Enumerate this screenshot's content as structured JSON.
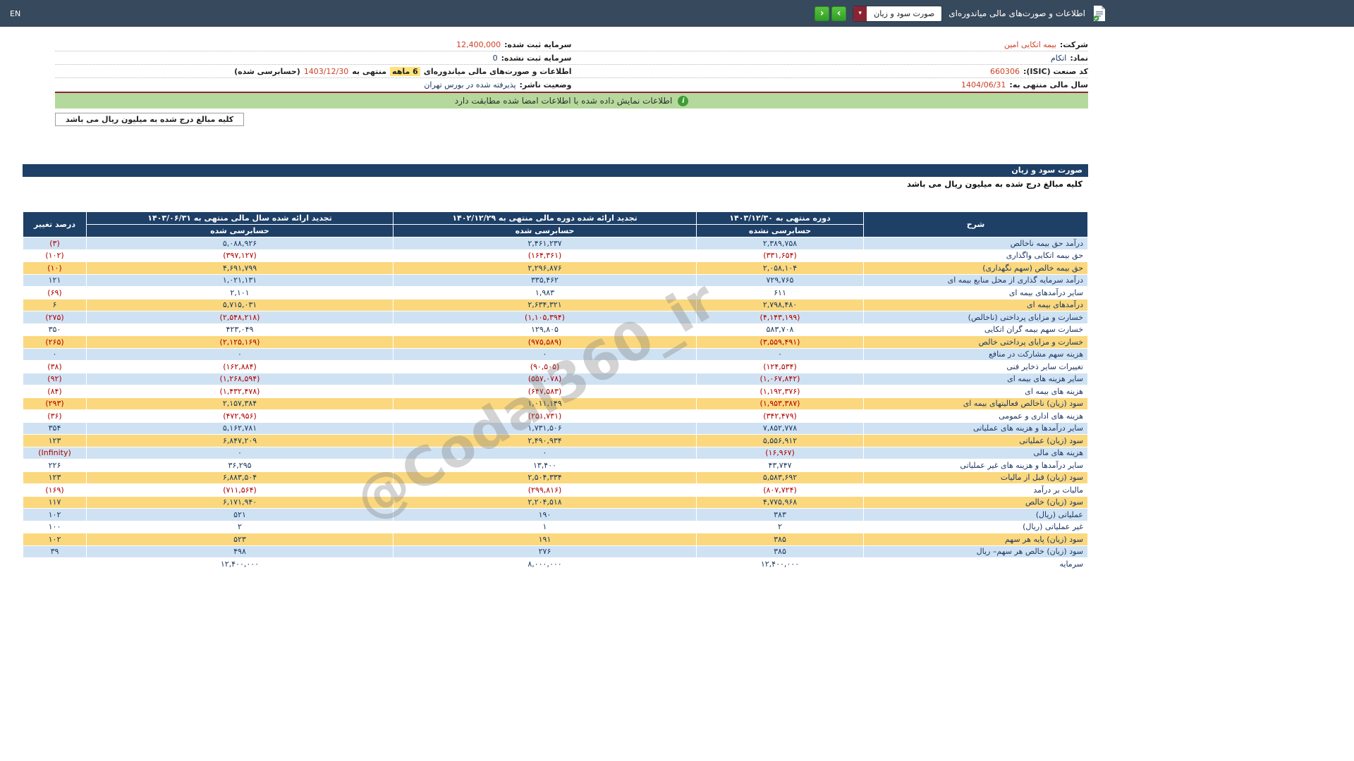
{
  "topbar": {
    "title": "اطلاعات و صورت‌های مالی میاندوره‌ای",
    "select_value": "صورت سود و زیان",
    "en_label": "EN"
  },
  "icons": {
    "dropdown_arrow": "▾",
    "nav_left": "‹",
    "nav_right": "›",
    "info_mark": "i"
  },
  "info": {
    "company_label": "شرکت:",
    "company_value": "بیمه اتکایی امین",
    "symbol_label": "نماد:",
    "symbol_value": "اتکام",
    "isic_label": "کد صنعت (ISIC):",
    "isic_value": "660306",
    "fiscal_year_label": "سال مالی منتهی به:",
    "fiscal_year_value": "1404/06/31",
    "registered_capital_label": "سرمایه ثبت شده:",
    "registered_capital_value": "12,400,000",
    "unregistered_capital_label": "سرمایه ثبت نشده:",
    "unregistered_capital_value": "0",
    "interim": {
      "prefix": "اطلاعات و صورت‌های مالی میاندوره‌ای",
      "highlight": "6 ماهه",
      "mid": "منتهی به",
      "date": "1403/12/30",
      "suffix": "(حسابرسی شده)"
    },
    "status_label": "وضعیت ناشر:",
    "status_value": "پذیرفته شده در بورس تهران",
    "signed_notice": "اطلاعات نمایش داده شده با اطلاعات امضا شده مطابقت دارد",
    "unit_note": "کلیه مبالغ درج شده به میلیون ریال می باشد"
  },
  "section": {
    "title": "صورت سود و زیان",
    "unit_note": "کلیه مبالغ درج شده به میلیون ریال می باشد"
  },
  "watermark": "@Codal360_ir",
  "table": {
    "headers": {
      "desc": "شرح",
      "col1": "دوره منتهی به ۱۴۰۳/۱۲/۳۰",
      "col1_sub": "حسابرسی نشده",
      "col2": "تجدید ارائه شده دوره مالی منتهی به ۱۴۰۲/۱۲/۲۹",
      "col2_sub": "حسابرسی شده",
      "col3": "تجدید ارائه شده سال مالی منتهی به ۱۴۰۳/۰۶/۳۱",
      "col3_sub": "حسابرسی شده",
      "change": "درصد تغییر"
    },
    "rows": [
      {
        "label": "درآمد حق بیمه ناخالص",
        "values": [
          "۲,۳۸۹,۷۵۸",
          "۲,۴۶۱,۲۳۷",
          "۵,۰۸۸,۹۲۶"
        ],
        "change": "(۳)",
        "bg": "blue"
      },
      {
        "label": "حق بیمه اتکایی واگذاری",
        "values": [
          "(۳۳۱,۶۵۴)",
          "(۱۶۴,۳۶۱)",
          "(۳۹۷,۱۲۷)"
        ],
        "change": "(۱۰۲)",
        "bg": "white"
      },
      {
        "label": "حق بیمه خالص (سهم نگهداری)",
        "values": [
          "۲,۰۵۸,۱۰۴",
          "۲,۲۹۶,۸۷۶",
          "۴,۶۹۱,۷۹۹"
        ],
        "change": "(۱۰)",
        "bg": "yellow"
      },
      {
        "label": "درآمد سرمایه گذاری از محل منابع بیمه ای",
        "values": [
          "۷۲۹,۷۶۵",
          "۳۳۵,۴۶۲",
          "۱,۰۲۱,۱۳۱"
        ],
        "change": "۱۲۱",
        "bg": "blue"
      },
      {
        "label": "سایر درآمدهای بیمه ای",
        "values": [
          "۶۱۱",
          "۱,۹۸۳",
          "۲,۱۰۱"
        ],
        "change": "(۶۹)",
        "bg": "white"
      },
      {
        "label": "درآمدهای بیمه ای",
        "values": [
          "۲,۷۹۸,۴۸۰",
          "۲,۶۳۴,۳۲۱",
          "۵,۷۱۵,۰۳۱"
        ],
        "change": "۶",
        "bg": "yellow"
      },
      {
        "label": "خسارت و مزایای پرداختی (ناخالص)",
        "values": [
          "(۴,۱۴۳,۱۹۹)",
          "(۱,۱۰۵,۳۹۴)",
          "(۲,۵۴۸,۲۱۸)"
        ],
        "change": "(۲۷۵)",
        "bg": "blue"
      },
      {
        "label": "خسارت سهم بیمه گران اتکایی",
        "values": [
          "۵۸۳,۷۰۸",
          "۱۲۹,۸۰۵",
          "۴۲۳,۰۴۹"
        ],
        "change": "۳۵۰",
        "bg": "white"
      },
      {
        "label": "خسارت و مزایای پرداختی خالص",
        "values": [
          "(۳,۵۵۹,۴۹۱)",
          "(۹۷۵,۵۸۹)",
          "(۲,۱۲۵,۱۶۹)"
        ],
        "change": "(۲۶۵)",
        "bg": "yellow"
      },
      {
        "label": "هزینه سهم مشارکت در منافع",
        "values": [
          "۰",
          "۰",
          "۰"
        ],
        "change": "۰",
        "bg": "blue"
      },
      {
        "label": "تغییرات سایر ذخایر فنی",
        "values": [
          "(۱۲۴,۵۳۴)",
          "(۹۰,۵۰۵)",
          "(۱۶۲,۸۸۴)"
        ],
        "change": "(۳۸)",
        "bg": "white"
      },
      {
        "label": "سایر هزینه های بیمه ای",
        "values": [
          "(۱,۰۶۷,۸۴۲)",
          "(۵۵۷,۰۷۸)",
          "(۱,۲۶۸,۵۹۴)"
        ],
        "change": "(۹۲)",
        "bg": "blue"
      },
      {
        "label": "هزینه های بیمه ای",
        "values": [
          "(۱,۱۹۲,۳۷۶)",
          "(۶۴۷,۵۸۳)",
          "(۱,۴۳۲,۴۷۸)"
        ],
        "change": "(۸۴)",
        "bg": "white"
      },
      {
        "label": "سود (زیان) ناخالص فعالیتهای بیمه ای",
        "values": [
          "(۱,۹۵۳,۳۸۷)",
          "۱,۰۱۱,۱۴۹",
          "۲,۱۵۷,۳۸۴"
        ],
        "change": "(۲۹۳)",
        "bg": "yellow"
      },
      {
        "label": "هزینه های اداری و عمومی",
        "values": [
          "(۳۴۲,۴۷۹)",
          "(۲۵۱,۷۳۱)",
          "(۴۷۲,۹۵۶)"
        ],
        "change": "(۳۶)",
        "bg": "white"
      },
      {
        "label": "سایر درآمدها و هزینه های عملیاتی",
        "values": [
          "۷,۸۵۲,۷۷۸",
          "۱,۷۳۱,۵۰۶",
          "۵,۱۶۲,۷۸۱"
        ],
        "change": "۳۵۴",
        "bg": "blue"
      },
      {
        "label": "سود (زیان) عملیاتی",
        "values": [
          "۵,۵۵۶,۹۱۲",
          "۲,۴۹۰,۹۳۴",
          "۶,۸۴۷,۲۰۹"
        ],
        "change": "۱۲۳",
        "bg": "yellow"
      },
      {
        "label": "هزینه های مالی",
        "values": [
          "(۱۶,۹۶۷)",
          "۰",
          "۰"
        ],
        "change": "(Infinity)",
        "bg": "blue"
      },
      {
        "label": "سایر درآمدها و هزینه های غیر عملیاتی",
        "values": [
          "۴۳,۷۴۷",
          "۱۳,۴۰۰",
          "۳۶,۲۹۵"
        ],
        "change": "۲۲۶",
        "bg": "white"
      },
      {
        "label": "سود (زیان) قبل از مالیات",
        "values": [
          "۵,۵۸۳,۶۹۲",
          "۲,۵۰۴,۳۳۴",
          "۶,۸۸۳,۵۰۴"
        ],
        "change": "۱۲۳",
        "bg": "yellow"
      },
      {
        "label": "مالیات بر درآمد",
        "values": [
          "(۸۰۷,۷۲۴)",
          "(۲۹۹,۸۱۶)",
          "(۷۱۱,۵۶۴)"
        ],
        "change": "(۱۶۹)",
        "bg": "white"
      },
      {
        "label": "سود (زیان) خالص",
        "values": [
          "۴,۷۷۵,۹۶۸",
          "۲,۲۰۴,۵۱۸",
          "۶,۱۷۱,۹۴۰"
        ],
        "change": "۱۱۷",
        "bg": "yellow"
      },
      {
        "label": "عملیاتی (ریال)",
        "values": [
          "۳۸۳",
          "۱۹۰",
          "۵۲۱"
        ],
        "change": "۱۰۲",
        "bg": "blue"
      },
      {
        "label": "غیر عملیاتی (ریال)",
        "values": [
          "۲",
          "۱",
          "۲"
        ],
        "change": "۱۰۰",
        "bg": "white"
      },
      {
        "label": "سود (زیان) پایه هر سهم",
        "values": [
          "۳۸۵",
          "۱۹۱",
          "۵۲۳"
        ],
        "change": "۱۰۲",
        "bg": "yellow"
      },
      {
        "label": "سود (زیان) خالص هر سهم– ریال",
        "values": [
          "۳۸۵",
          "۲۷۶",
          "۴۹۸"
        ],
        "change": "۳۹",
        "bg": "blue"
      },
      {
        "label": "سرمایه",
        "values": [
          "۱۲,۴۰۰,۰۰۰",
          "۸,۰۰۰,۰۰۰",
          "۱۲,۴۰۰,۰۰۰"
        ],
        "change": "",
        "bg": "white"
      }
    ]
  }
}
